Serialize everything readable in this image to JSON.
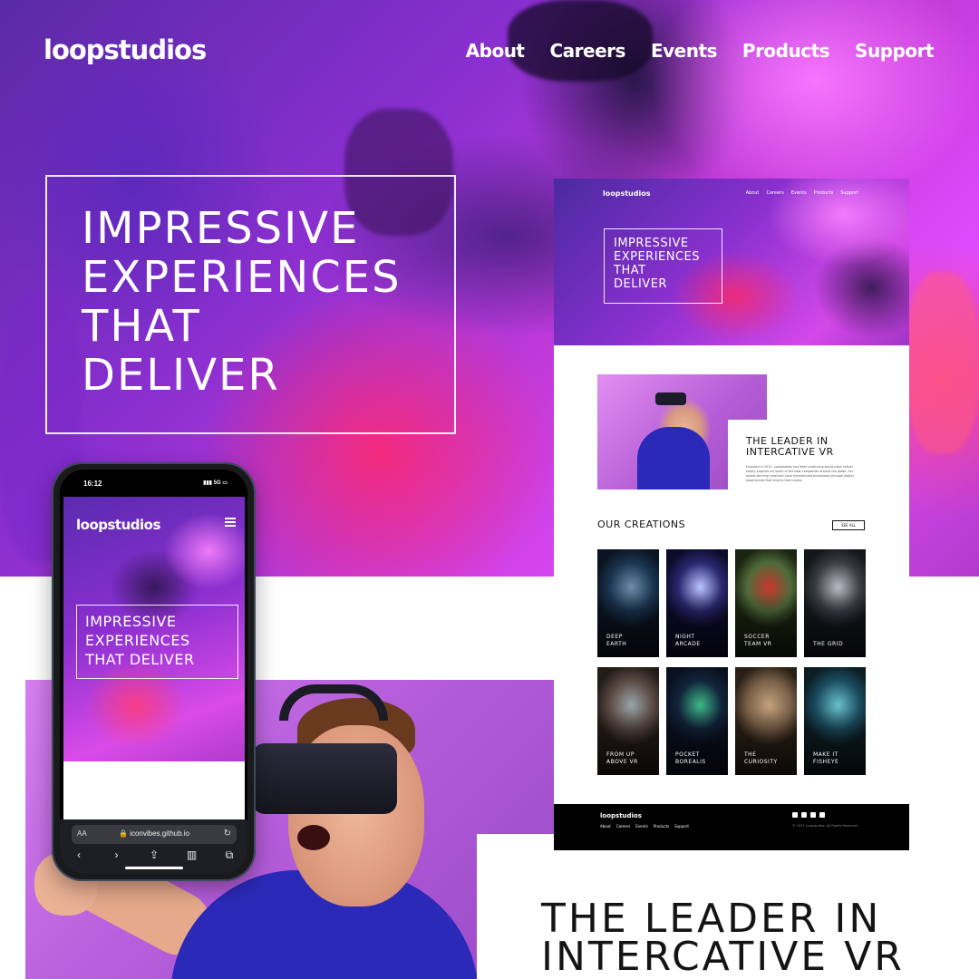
{
  "hero": {
    "logo": "loopstudios",
    "nav": [
      "About",
      "Careers",
      "Events",
      "Products",
      "Support"
    ],
    "headline": [
      "IMPRESSIVE",
      "EXPERIENCES",
      "THAT",
      "DELIVER"
    ]
  },
  "desktop": {
    "logo": "loopstudios",
    "nav": [
      "About",
      "Careers",
      "Events",
      "Products",
      "Support"
    ],
    "headline": [
      "IMPRESSIVE",
      "EXPERIENCES",
      "THAT",
      "DELIVER"
    ],
    "leader_title": [
      "THE LEADER IN",
      "INTERCATIVE VR"
    ],
    "leader_text": "Founded in 2011, Loopstudios has been producing world-class virtual reality projects for some of the best companies around the globe. Our award-winning creations have transformed businesses through digital experiences that bind to their brand.",
    "creations_heading": "OUR CREATIONS",
    "see_all": "SEE ALL",
    "creations": [
      {
        "label": "DEEP\nEARTH",
        "colors": [
          "#1a3550",
          "#6d8ca8",
          "#0b1422"
        ]
      },
      {
        "label": "NIGHT\nARCADE",
        "colors": [
          "#2a2870",
          "#b9c3ff",
          "#0d0b2a"
        ]
      },
      {
        "label": "SOCCER\nTEAM VR",
        "colors": [
          "#4f6b3a",
          "#c9362e",
          "#1a2410"
        ]
      },
      {
        "label": "THE GRID",
        "colors": [
          "#3b3f46",
          "#b7bcc4",
          "#15171b"
        ]
      },
      {
        "label": "FROM UP\nABOVE VR",
        "colors": [
          "#5a4a44",
          "#9aa5a8",
          "#231c18"
        ]
      },
      {
        "label": "POCKET\nBOREALIS",
        "colors": [
          "#11243a",
          "#3fb88a",
          "#0a1020"
        ]
      },
      {
        "label": "THE\nCURIOSITY",
        "colors": [
          "#7a6048",
          "#c2a27e",
          "#2b2016"
        ]
      },
      {
        "label": "MAKE IT\nFISHEYE",
        "colors": [
          "#1b4d60",
          "#6ac0c9",
          "#0c1d24"
        ]
      }
    ],
    "footer": {
      "logo": "loopstudios",
      "nav": [
        "About",
        "Careers",
        "Events",
        "Products",
        "Support"
      ],
      "copyright": "© 2021 Loopstudios. All Rights Reserved."
    }
  },
  "phone": {
    "time": "16:12",
    "signal": "5G",
    "logo": "loopstudios",
    "headline": [
      "IMPRESSIVE",
      "EXPERIENCES",
      "THAT DELIVER"
    ],
    "text_size_label": "AA",
    "url": "iconvibes.github.io",
    "toolbar_icons": [
      "back-icon",
      "forward-icon",
      "share-icon",
      "bookmarks-icon",
      "tabs-icon"
    ]
  },
  "leader": {
    "title": [
      "THE LEADER IN",
      "INTERCATIVE VR"
    ]
  }
}
